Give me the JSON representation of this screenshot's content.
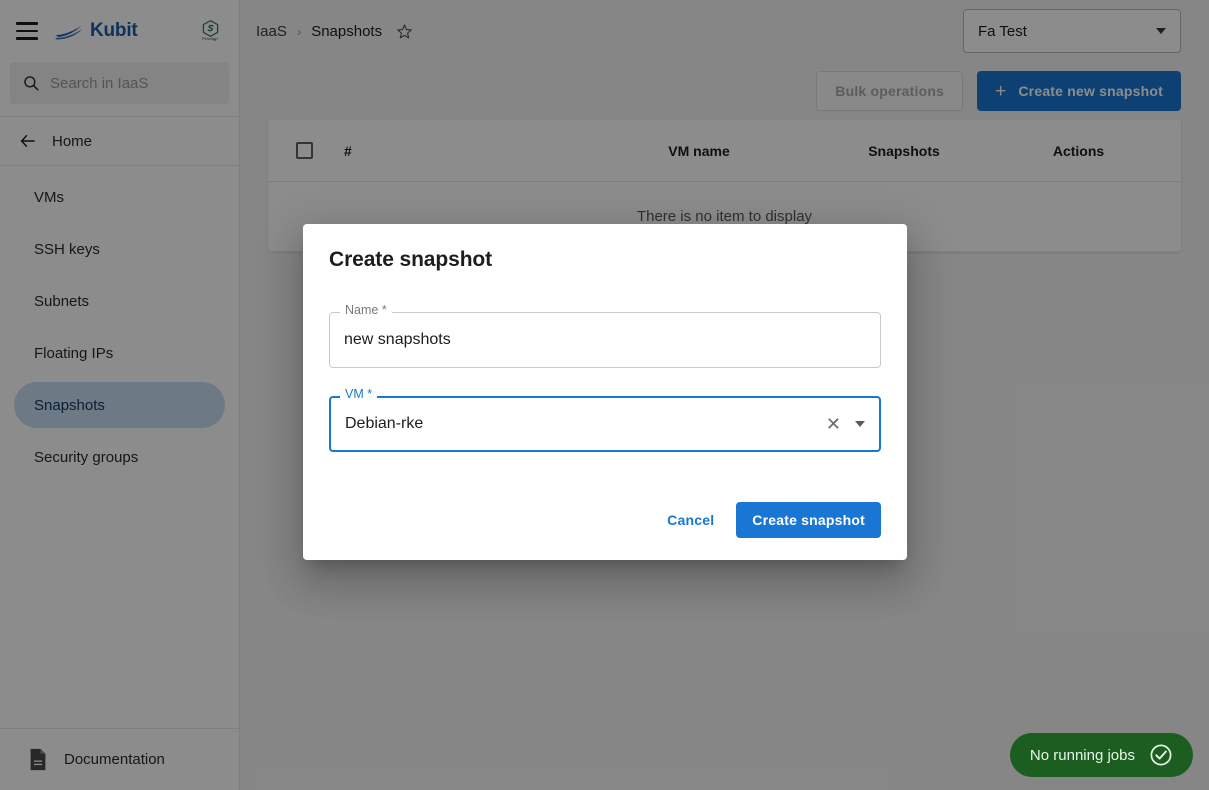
{
  "app": {
    "brand_name": "Kubit",
    "partner_sub_label": "Pénzügyi"
  },
  "sidebar": {
    "menu_icon": "hamburger-icon",
    "search": {
      "icon": "search-icon",
      "placeholder": "Search in IaaS",
      "value": ""
    },
    "home": {
      "icon": "arrow-left-icon",
      "label": "Home"
    },
    "items": [
      {
        "label": "VMs",
        "active": false
      },
      {
        "label": "SSH keys",
        "active": false
      },
      {
        "label": "Subnets",
        "active": false
      },
      {
        "label": "Floating IPs",
        "active": false
      },
      {
        "label": "Snapshots",
        "active": true
      },
      {
        "label": "Security groups",
        "active": false
      }
    ],
    "footer": {
      "icon": "document-icon",
      "label": "Documentation"
    }
  },
  "header": {
    "breadcrumb": {
      "root": "IaaS",
      "separator": "›",
      "current": "Snapshots",
      "favorite_icon": "star-outline-icon"
    },
    "project_selector": {
      "value": "Fa Test",
      "icon": "chevron-down-icon"
    }
  },
  "toolbar": {
    "bulk_operations_label": "Bulk operations",
    "bulk_operations_disabled": true,
    "create_new_label": "Create new snapshot",
    "create_new_icon": "plus-icon"
  },
  "table": {
    "select_all_icon": "checkbox-unchecked-icon",
    "columns": [
      "#",
      "VM name",
      "Snapshots",
      "Actions"
    ],
    "empty_message": "There is no item to display",
    "rows": []
  },
  "dialog": {
    "title": "Create snapshot",
    "fields": [
      {
        "label": "Name *",
        "value": "new snapshots",
        "focused": false,
        "type": "text"
      },
      {
        "label": "VM *",
        "value": "Debian-rke",
        "focused": true,
        "type": "select",
        "clear_icon": "close-x-icon",
        "dropdown_icon": "triangle-down-icon"
      }
    ],
    "cancel_label": "Cancel",
    "confirm_label": "Create snapshot"
  },
  "toast": {
    "label": "No running jobs",
    "icon": "check-circle-icon",
    "color": "#1b5e20"
  },
  "colors": {
    "primary": "#1976d2",
    "brand": "#1a5ba6",
    "active_nav": "#c9ddf4",
    "success": "#1b5e20",
    "overlay": "rgba(0,0,0,0.45)"
  }
}
